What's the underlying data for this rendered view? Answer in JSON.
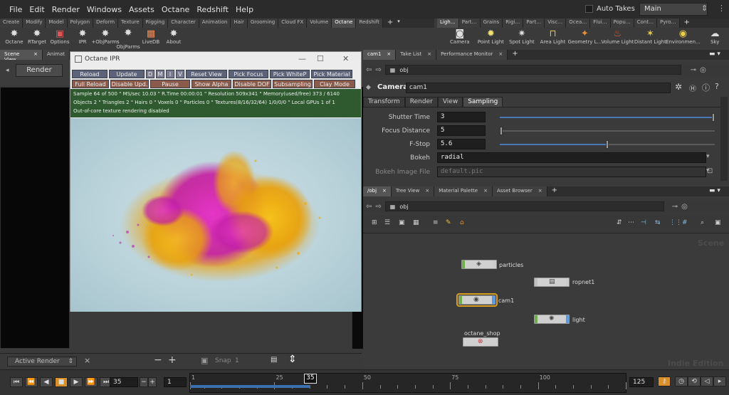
{
  "menu": [
    "File",
    "Edit",
    "Render",
    "Windows",
    "Assets",
    "Octane",
    "Redshift",
    "Help"
  ],
  "auto_takes": "Auto Takes",
  "desktop": "Main",
  "shelf_tabs_left": [
    "Create",
    "Modify",
    "Model",
    "Polygon",
    "Deform",
    "Texture",
    "Rigging",
    "Character",
    "Animation",
    "Hair",
    "Grooming",
    "Cloud FX",
    "Volume",
    "Octane",
    "Redshift"
  ],
  "shelf_tabs_right": [
    "Ligh…",
    "Part…",
    "Grains",
    "Rigi…",
    "Part…",
    "Visc…",
    "Ocea…",
    "Flui…",
    "Popu…",
    "Cont…",
    "Pyro…"
  ],
  "left_tools": [
    {
      "label": "Octane",
      "icon": "octane-icon",
      "color": "#ddd"
    },
    {
      "label": "RTarget",
      "icon": "rtarget-icon",
      "color": "#ddd"
    },
    {
      "label": "Options",
      "icon": "options-icon",
      "color": "#d55"
    },
    {
      "label": "IPR",
      "icon": "ipr-icon",
      "color": "#ddd"
    },
    {
      "label": "+ObjParms",
      "icon": "objparms-add-icon",
      "color": "#ddd"
    },
    {
      "label": "-ObjParms",
      "icon": "objparms-remove-icon",
      "color": "#ddd"
    },
    {
      "label": "LiveDB",
      "icon": "livedb-icon",
      "color": "#e85"
    },
    {
      "label": "About",
      "icon": "about-icon",
      "color": "#ddd"
    }
  ],
  "right_tools": [
    {
      "label": "Camera",
      "icon": "camera-icon"
    },
    {
      "label": "Point Light",
      "icon": "point-light-icon"
    },
    {
      "label": "Spot Light",
      "icon": "spot-light-icon"
    },
    {
      "label": "Area Light",
      "icon": "area-light-icon"
    },
    {
      "label": "Geometry L...",
      "icon": "geometry-light-icon"
    },
    {
      "label": "Volume Light",
      "icon": "volume-light-icon"
    },
    {
      "label": "Distant Light",
      "icon": "distant-light-icon"
    },
    {
      "label": "Environmen...",
      "icon": "environment-light-icon"
    },
    {
      "label": "Sky",
      "icon": "sky-light-icon"
    }
  ],
  "left_tabs": [
    "Scene View",
    "Animat"
  ],
  "render_btn": "Render",
  "ipr": {
    "title": "Octane IPR",
    "row1": [
      "Reload",
      "Update",
      "D",
      "M",
      "I",
      "V",
      "Reset View",
      "Pick Focus",
      "Pick WhiteP",
      "Pick Material"
    ],
    "row2": [
      "Full Reload",
      "Disable Upd.",
      "Pause",
      "Show Alpha",
      "Disable DOF",
      "Subsampling",
      "Clay Mode"
    ],
    "info": [
      "Sample 64 of 500 \" MS/sec 10.03 \" R.Time 00:00:01 \" Resolution 509x341 \" Memory(used/free) 373 / 6140",
      "Objects 2 \" Triangles 2 \" Hairs 0 \" Voxels 0 \" Particles 0 \" Textures(8/16/32/64) 1/0/0/0 \" Local GPUs 1 of 1",
      "Out-of-core texture rendering disabled"
    ]
  },
  "params_tabs": [
    "cam1",
    "Take List",
    "Performance Monitor"
  ],
  "params_path": "obj",
  "camera": {
    "type": "Camera",
    "name": "cam1"
  },
  "param_subtabs": [
    "Transform",
    "Render",
    "View",
    "Sampling"
  ],
  "params": [
    {
      "label": "Shutter Time",
      "value": "3",
      "fill": 1.0
    },
    {
      "label": "Focus Distance",
      "value": "5",
      "fill": 0.0
    },
    {
      "label": "F-Stop",
      "value": "5.6",
      "fill": 0.5
    },
    {
      "label": "Bokeh",
      "value": "radial"
    },
    {
      "label": "Bokeh Image File",
      "value": "default.pic"
    }
  ],
  "net_tabs": [
    "/obj",
    "Tree View",
    "Material Palette",
    "Asset Browser"
  ],
  "net_path": "obj",
  "scene_label": "Scene",
  "edition": "Indie Edition",
  "nodes": [
    {
      "name": "particles"
    },
    {
      "name": "ropnet1"
    },
    {
      "name": "cam1"
    },
    {
      "name": "light"
    },
    {
      "name": "octane_shop"
    }
  ],
  "bottom_left": {
    "label": "Active Render",
    "snap": "Snap",
    "snap_num": "1"
  },
  "timeline": {
    "start_frame": "35",
    "step": "1",
    "current": "35",
    "end": "125",
    "ticks": [
      "1",
      "25",
      "50",
      "75",
      "100"
    ],
    "current_fraction": 0.276
  },
  "colors": {
    "accent": "#d9902b",
    "ipr_green": "#2f5a2f",
    "timeline_blue": "#3a6fb0"
  }
}
